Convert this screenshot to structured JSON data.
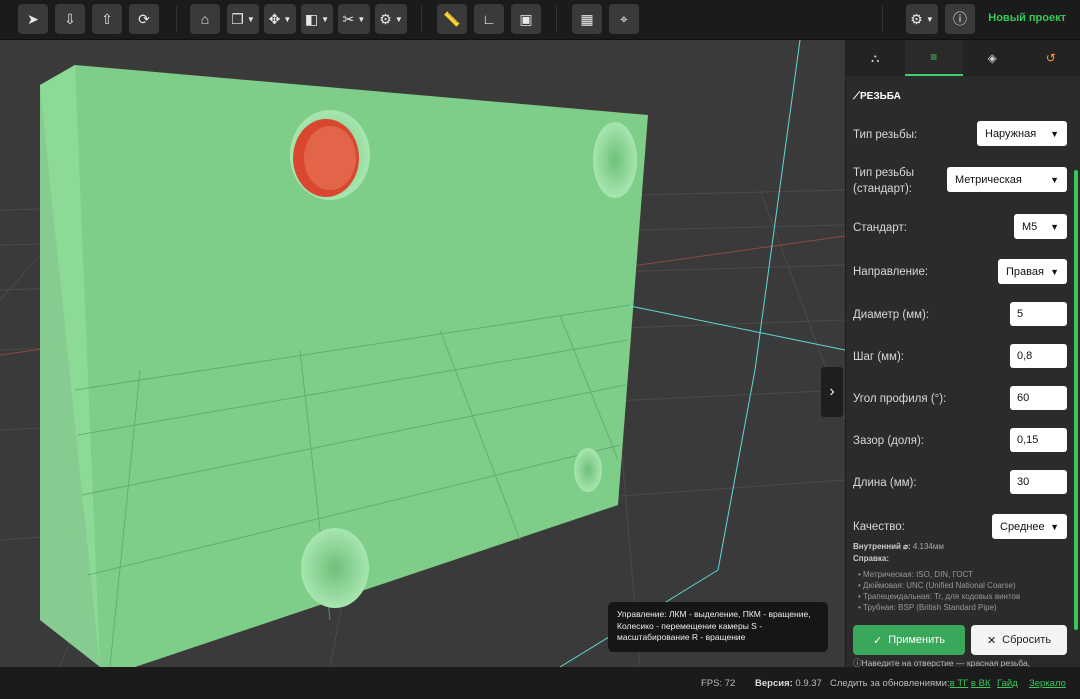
{
  "toolbar": {
    "project_name": "Новый проект",
    "buttons": [
      "select-icon",
      "import-icon",
      "export-icon",
      "refresh-icon",
      "shape-icon",
      "copy-icon",
      "move-icon",
      "boolean-icon",
      "tools-icon",
      "settings-icon",
      "ruler-icon",
      "angle-icon",
      "bounds-icon",
      "grid-icon",
      "snap-icon",
      "gear-icon",
      "info-icon"
    ]
  },
  "panel": {
    "tabs": [
      "shapes-icon",
      "sliders-icon",
      "layers-icon",
      "history-icon"
    ],
    "section_title": "РЕЗЬБА",
    "thread_type_label": "Тип резьбы:",
    "thread_type_value": "Наружная",
    "thread_standard_type_label": "Тип резьбы (стандарт):",
    "thread_standard_type_value": "Метрическая",
    "standard_label": "Стандарт:",
    "standard_value": "M5",
    "direction_label": "Направление:",
    "direction_value": "Правая",
    "diameter_label": "Диаметр (мм):",
    "diameter_value": "5",
    "pitch_label": "Шаг (мм):",
    "pitch_value": "0,8",
    "angle_label": "Угол профиля (°):",
    "angle_value": "60",
    "clearance_label": "Зазор (доля):",
    "clearance_value": "0,15",
    "length_label": "Длина (мм):",
    "length_value": "30",
    "quality_label": "Качество:",
    "quality_value": "Среднее",
    "inner_label": "Внутренний ⌀:",
    "inner_value": "4.134мм",
    "help_title": "Справка:",
    "help_items": [
      "Метрическая: ISO, DIN, ГОСТ",
      "Дюймовая: UNC (Unified National Coarse)",
      "Трапецеидальная: Tr, для ходовых винтов",
      "Трубная: BSP (British Standard Pipe)"
    ],
    "apply_label": "Применить",
    "reset_label": "Сбросить",
    "hint": "Наведите на отверстие — красная резьба,"
  },
  "tooltip": "Управление: ЛКМ - выделение, ПКМ - вращение, Колесико - перемещение камеры S - масштабирование R - вращение",
  "status": {
    "fps": "FPS: 72",
    "version_label": "Версия:",
    "version_value": "0.9.37",
    "follow_text": "Следить за обновлениями:",
    "tg": "в ТГ",
    "vk": "в ВК",
    "guide": "Гайд",
    "mirror": "Зеркало"
  },
  "colors": {
    "accent": "#38c85a",
    "part": "#7fd08a",
    "hole_highlight": "#d9472f"
  }
}
